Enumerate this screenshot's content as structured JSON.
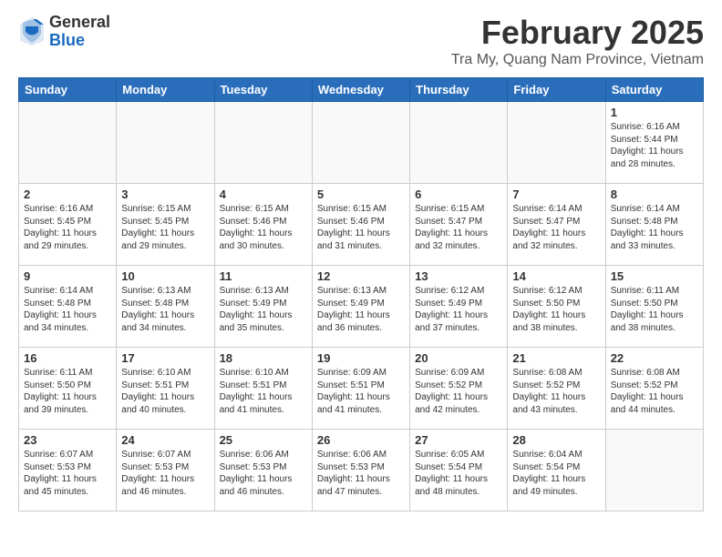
{
  "header": {
    "logo_general": "General",
    "logo_blue": "Blue",
    "month_title": "February 2025",
    "location": "Tra My, Quang Nam Province, Vietnam"
  },
  "weekdays": [
    "Sunday",
    "Monday",
    "Tuesday",
    "Wednesday",
    "Thursday",
    "Friday",
    "Saturday"
  ],
  "weeks": [
    [
      {
        "day": "",
        "info": ""
      },
      {
        "day": "",
        "info": ""
      },
      {
        "day": "",
        "info": ""
      },
      {
        "day": "",
        "info": ""
      },
      {
        "day": "",
        "info": ""
      },
      {
        "day": "",
        "info": ""
      },
      {
        "day": "1",
        "info": "Sunrise: 6:16 AM\nSunset: 5:44 PM\nDaylight: 11 hours and 28 minutes."
      }
    ],
    [
      {
        "day": "2",
        "info": "Sunrise: 6:16 AM\nSunset: 5:45 PM\nDaylight: 11 hours and 29 minutes."
      },
      {
        "day": "3",
        "info": "Sunrise: 6:15 AM\nSunset: 5:45 PM\nDaylight: 11 hours and 29 minutes."
      },
      {
        "day": "4",
        "info": "Sunrise: 6:15 AM\nSunset: 5:46 PM\nDaylight: 11 hours and 30 minutes."
      },
      {
        "day": "5",
        "info": "Sunrise: 6:15 AM\nSunset: 5:46 PM\nDaylight: 11 hours and 31 minutes."
      },
      {
        "day": "6",
        "info": "Sunrise: 6:15 AM\nSunset: 5:47 PM\nDaylight: 11 hours and 32 minutes."
      },
      {
        "day": "7",
        "info": "Sunrise: 6:14 AM\nSunset: 5:47 PM\nDaylight: 11 hours and 32 minutes."
      },
      {
        "day": "8",
        "info": "Sunrise: 6:14 AM\nSunset: 5:48 PM\nDaylight: 11 hours and 33 minutes."
      }
    ],
    [
      {
        "day": "9",
        "info": "Sunrise: 6:14 AM\nSunset: 5:48 PM\nDaylight: 11 hours and 34 minutes."
      },
      {
        "day": "10",
        "info": "Sunrise: 6:13 AM\nSunset: 5:48 PM\nDaylight: 11 hours and 34 minutes."
      },
      {
        "day": "11",
        "info": "Sunrise: 6:13 AM\nSunset: 5:49 PM\nDaylight: 11 hours and 35 minutes."
      },
      {
        "day": "12",
        "info": "Sunrise: 6:13 AM\nSunset: 5:49 PM\nDaylight: 11 hours and 36 minutes."
      },
      {
        "day": "13",
        "info": "Sunrise: 6:12 AM\nSunset: 5:49 PM\nDaylight: 11 hours and 37 minutes."
      },
      {
        "day": "14",
        "info": "Sunrise: 6:12 AM\nSunset: 5:50 PM\nDaylight: 11 hours and 38 minutes."
      },
      {
        "day": "15",
        "info": "Sunrise: 6:11 AM\nSunset: 5:50 PM\nDaylight: 11 hours and 38 minutes."
      }
    ],
    [
      {
        "day": "16",
        "info": "Sunrise: 6:11 AM\nSunset: 5:50 PM\nDaylight: 11 hours and 39 minutes."
      },
      {
        "day": "17",
        "info": "Sunrise: 6:10 AM\nSunset: 5:51 PM\nDaylight: 11 hours and 40 minutes."
      },
      {
        "day": "18",
        "info": "Sunrise: 6:10 AM\nSunset: 5:51 PM\nDaylight: 11 hours and 41 minutes."
      },
      {
        "day": "19",
        "info": "Sunrise: 6:09 AM\nSunset: 5:51 PM\nDaylight: 11 hours and 41 minutes."
      },
      {
        "day": "20",
        "info": "Sunrise: 6:09 AM\nSunset: 5:52 PM\nDaylight: 11 hours and 42 minutes."
      },
      {
        "day": "21",
        "info": "Sunrise: 6:08 AM\nSunset: 5:52 PM\nDaylight: 11 hours and 43 minutes."
      },
      {
        "day": "22",
        "info": "Sunrise: 6:08 AM\nSunset: 5:52 PM\nDaylight: 11 hours and 44 minutes."
      }
    ],
    [
      {
        "day": "23",
        "info": "Sunrise: 6:07 AM\nSunset: 5:53 PM\nDaylight: 11 hours and 45 minutes."
      },
      {
        "day": "24",
        "info": "Sunrise: 6:07 AM\nSunset: 5:53 PM\nDaylight: 11 hours and 46 minutes."
      },
      {
        "day": "25",
        "info": "Sunrise: 6:06 AM\nSunset: 5:53 PM\nDaylight: 11 hours and 46 minutes."
      },
      {
        "day": "26",
        "info": "Sunrise: 6:06 AM\nSunset: 5:53 PM\nDaylight: 11 hours and 47 minutes."
      },
      {
        "day": "27",
        "info": "Sunrise: 6:05 AM\nSunset: 5:54 PM\nDaylight: 11 hours and 48 minutes."
      },
      {
        "day": "28",
        "info": "Sunrise: 6:04 AM\nSunset: 5:54 PM\nDaylight: 11 hours and 49 minutes."
      },
      {
        "day": "",
        "info": ""
      }
    ]
  ]
}
